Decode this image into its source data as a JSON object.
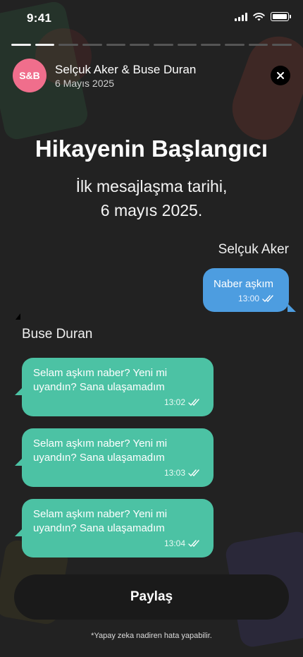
{
  "status_bar": {
    "time": "9:41"
  },
  "progress": {
    "total_segments": 12,
    "completed_segments": 2
  },
  "header": {
    "avatar_initials": "S&B",
    "avatar_color": "#f06e8c",
    "names": "Selçuk  Aker & Buse Duran",
    "date": "6 Mayıs 2025"
  },
  "story": {
    "title": "Hikayenin Başlangıcı",
    "subtitle_line1": "İlk mesajlaşma tarihi,",
    "subtitle_line2": "6 mayıs 2025."
  },
  "chat": {
    "sender_right": "Selçuk Aker",
    "outgoing": {
      "text": "Naber aşkım",
      "time": "13:00",
      "color": "#4d9de0"
    },
    "sender_left": "Buse Duran",
    "incoming": [
      {
        "text": "Selam aşkım naber? Yeni mi uyandın? Sana ulaşamadım",
        "time": "13:02"
      },
      {
        "text": "Selam aşkım naber? Yeni mi uyandın? Sana ulaşamadım",
        "time": "13:03"
      },
      {
        "text": "Selam aşkım naber? Yeni mi uyandın? Sana ulaşamadım",
        "time": "13:04"
      }
    ],
    "incoming_color": "#4cc2a4"
  },
  "share_button": {
    "label": "Paylaş"
  },
  "disclaimer": "*Yapay zeka nadiren hata yapabilir.",
  "icons": {
    "close": "close-icon",
    "read_receipt": "double-check-icon",
    "signal": "signal-icon",
    "wifi": "wifi-icon",
    "battery": "battery-icon"
  }
}
